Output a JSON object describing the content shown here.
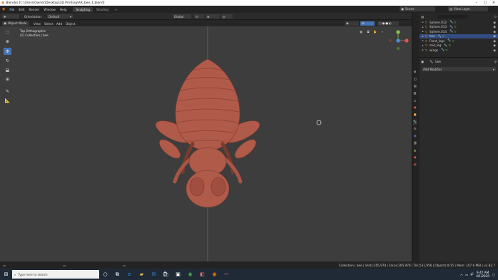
{
  "window": {
    "title": "Blender [C:\\Users\\Owner\\Desktop\\3D Printing\\AR_bee_1.blend]",
    "min_icon": "minimize-icon",
    "max_icon": "maximize-icon",
    "close_icon": "close-icon"
  },
  "menubar": {
    "items": [
      "File",
      "Edit",
      "Render",
      "Window",
      "Help"
    ],
    "workspaces": [
      "Sculpting",
      "Shading"
    ],
    "add_tab": "+",
    "scene_label": "Scene",
    "view_layer_label": "View Layer"
  },
  "viewport_header": {
    "orientation_label": "Orientation:",
    "orientation_value": "Default",
    "transform_global": "Global",
    "mode": "Object Mode",
    "menus": [
      "View",
      "Select",
      "Add",
      "Object"
    ]
  },
  "viewport": {
    "view_name": "Top Orthographic",
    "collection_info": "(1) Collection | bee",
    "gizmo_axes": [
      "X",
      "Y",
      "Z"
    ],
    "model_color": "#b05a4a",
    "background_color": "#3d3d3d"
  },
  "outliner": {
    "search_placeholder": "",
    "items": [
      {
        "name": "Sphere.012",
        "selected": false
      },
      {
        "name": "Sphere.013",
        "selected": false
      },
      {
        "name": "Sphere.014",
        "selected": false
      },
      {
        "name": "bee",
        "selected": true
      },
      {
        "name": "Front_legs",
        "selected": false
      },
      {
        "name": "mid_leg",
        "selected": false
      },
      {
        "name": "wings",
        "selected": false
      }
    ]
  },
  "properties": {
    "object_name": "bee",
    "add_modifier": "Add Modifier"
  },
  "statusbar": {
    "stats": "Collection | bee | Verts:265,978 | Faces:265,978 | Tris:531,956 | Objects:0/15 | Mem: 107.6 MiB | v2.82.7"
  },
  "taskbar": {
    "search_placeholder": "Type here to search",
    "time": "9:47 AM",
    "date": "4/1/2020"
  },
  "colors": {
    "accent": "#4772b3",
    "x_axis": "#e05858",
    "y_axis": "#8bc34a",
    "z_axis": "#4a90e2"
  }
}
